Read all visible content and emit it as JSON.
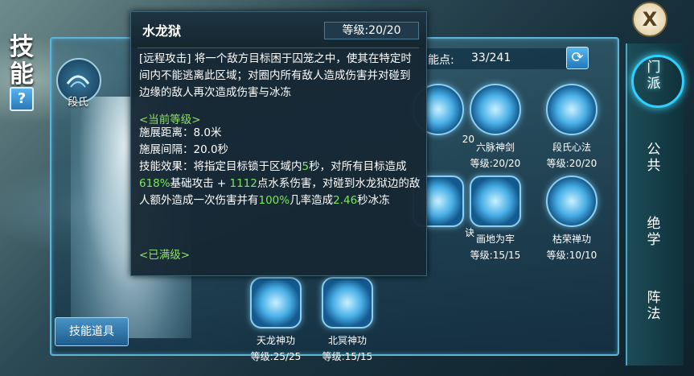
{
  "left": {
    "title_chars": [
      "技",
      "能"
    ],
    "help_label": "?",
    "school_label": "段氏",
    "skill_items_button": "技能道具"
  },
  "close_label": "X",
  "points": {
    "label": "能点:",
    "value": "33/241"
  },
  "skills": [
    {
      "name": "",
      "level": "20",
      "dim": false
    },
    {
      "name": "六脉神剑",
      "level": "等级:20/20",
      "dim": false
    },
    {
      "name": "段氏心法",
      "level": "等级:20/20",
      "dim": false
    },
    {
      "name": "诀",
      "level": "",
      "dim": false
    },
    {
      "name": "画地为牢",
      "level": "等级:15/15",
      "dim": false
    },
    {
      "name": "枯荣禅功",
      "level": "等级:10/10",
      "dim": false
    },
    {
      "name": "天龙神功",
      "level": "等级:25/25",
      "dim": false
    },
    {
      "name": "北冥神功",
      "level": "等级:15/15",
      "dim": false
    }
  ],
  "tabs": [
    "门派",
    "公共",
    "绝学",
    "阵法"
  ],
  "tooltip": {
    "title": "水龙狱",
    "level": "等级:20/20",
    "desc": "[远程攻击] 将一个敌方目标困于囚笼之中，使其在特定时间内不能逃离此区域；对圈内所有敌人造成伤害并对碰到边缘的敌人再次造成伤害与冰冻",
    "current_level_label": "<当前等级>",
    "range": "施展距离：8.0米",
    "interval": "施展间隔：20.0秒",
    "effect": {
      "p1": "技能效果：将指定目标锁于区域内",
      "n1": "5",
      "p2": "秒，对所有目标造成",
      "n2": "618%",
      "p3": "基础攻击 + ",
      "n3": "1112",
      "p4": "点水系伤害，对碰到水龙狱边的敌人额外造成一次伤害并有",
      "n4": "100%",
      "p5": "几率造成",
      "n5": "2.46",
      "p6": "秒冰冻"
    },
    "maxed_label": "<已满级>"
  },
  "colors": {
    "accent": "#5fb4d6",
    "highlight": "#7be85a"
  }
}
